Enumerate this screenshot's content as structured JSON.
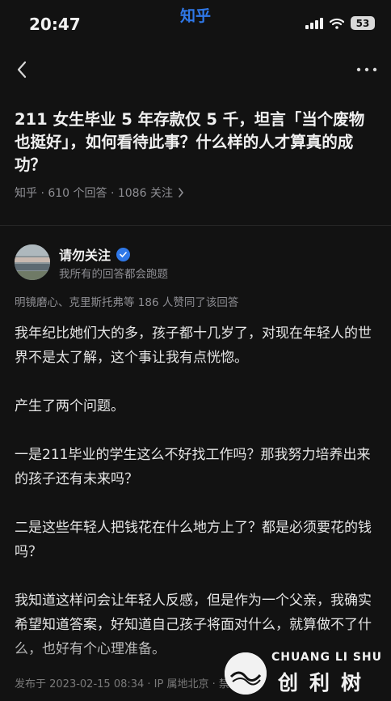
{
  "status_bar": {
    "time": "20:47",
    "app_name": "知乎",
    "battery": "53",
    "accent_color": "#2f78e8"
  },
  "nav": {
    "back_icon": "chevron-left-icon",
    "more_icon": "more-horizontal-icon"
  },
  "question": {
    "title": "211 女生毕业 5 年存款仅 5 千，坦言「当个废物也挺好」，如何看待此事？什么样的人才算真的成功？",
    "meta": "知乎 · 610 个回答 · 1086 关注",
    "meta_icon": "chevron-right-icon"
  },
  "answer": {
    "author_name": "请勿关注",
    "author_bio": "我所有的回答都会跑题",
    "upvote_text": "明镜磨心、克里斯托弗等 186 人赞同了该回答",
    "paragraphs": [
      "我年纪比她们大的多，孩子都十几岁了，对现在年轻人的世界不是太了解，这个事让我有点恍惚。",
      "产生了两个问题。",
      "一是211毕业的学生这么不好找工作吗？那我努力培养出来的孩子还有未来吗？",
      "二是这些年轻人把钱花在什么地方上了？都是必须要花的钱吗？",
      "我知道这样问会让年轻人反感，但是作为一个父亲，我确实希望知道答案，好知道自己孩子将面对什么，就算做不了什么，也好有个心理准备。"
    ],
    "footer": "发布于 2023-02-15 08:34 · IP 属地北京 · 禁止转载"
  },
  "watermark": {
    "top_text": "CHUANG LI SHU",
    "bottom_text": "创利树"
  }
}
